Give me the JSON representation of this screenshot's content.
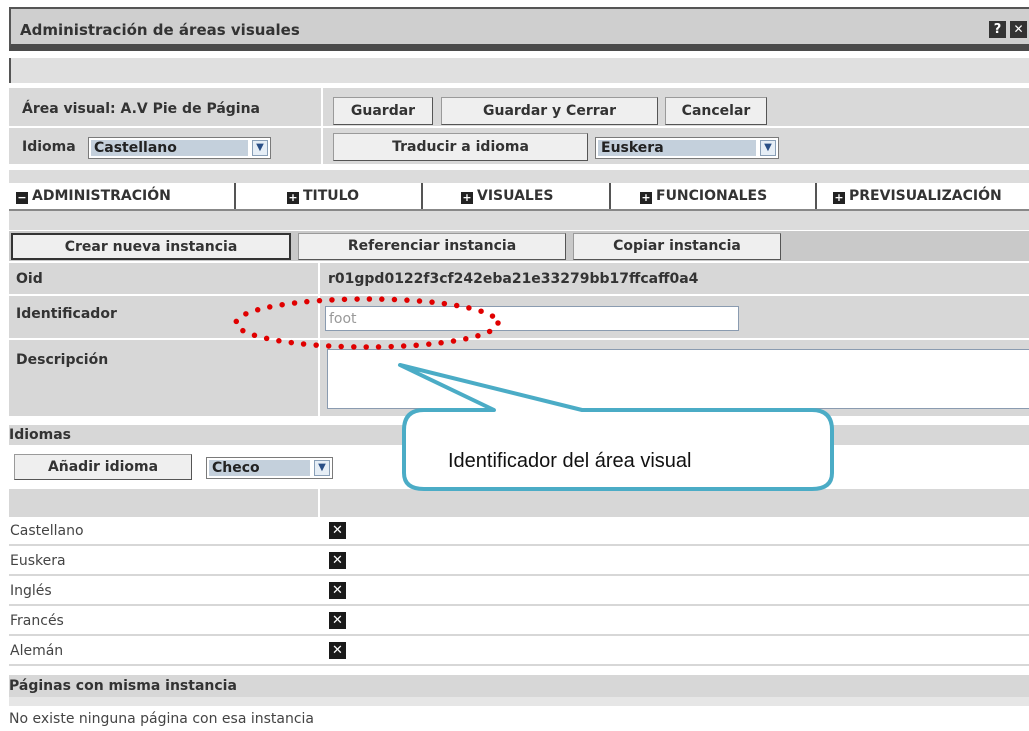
{
  "window": {
    "title": "Administración de áreas visuales",
    "help_label": "?",
    "close_label": "✕"
  },
  "header": {
    "area_label": "Área visual: A.V Pie de Página",
    "save_label": "Guardar",
    "save_close_label": "Guardar y Cerrar",
    "cancel_label": "Cancelar",
    "language_label": "Idioma",
    "language_value": "Castellano",
    "translate_label": "Traducir a idioma",
    "translate_target_value": "Euskera"
  },
  "tabs": [
    {
      "label": "ADMINISTRACIÓN",
      "icon": "minus-icon",
      "icon_glyph": "−"
    },
    {
      "label": "TITULO",
      "icon": "plus-icon",
      "icon_glyph": "+"
    },
    {
      "label": "VISUALES",
      "icon": "plus-icon",
      "icon_glyph": "+"
    },
    {
      "label": "FUNCIONALES",
      "icon": "plus-icon",
      "icon_glyph": "+"
    },
    {
      "label": "PREVISUALIZACIÓN",
      "icon": "plus-icon",
      "icon_glyph": "+"
    }
  ],
  "instance_buttons": {
    "create": "Crear nueva instancia",
    "reference": "Referenciar instancia",
    "copy": "Copiar instancia"
  },
  "form": {
    "oid_label": "Oid",
    "oid_value": "r01gpd0122f3cf242eba21e33279bb17ffcaff0a4",
    "identifier_label": "Identificador",
    "identifier_value": "foot",
    "description_label": "Descripción",
    "description_value": ""
  },
  "callout": {
    "text": "Identificador del área visual",
    "highlight_color": "#e00000",
    "border_color": "#4bacc6"
  },
  "languages": {
    "section_title": "Idiomas",
    "add_label": "Añadir idioma",
    "add_select_value": "Checo",
    "delete_icon": "delete-icon",
    "delete_glyph": "✕",
    "rows": [
      "Castellano",
      "Euskera",
      "Inglés",
      "Francés",
      "Alemán"
    ]
  },
  "pages": {
    "section_title": "Páginas con misma instancia",
    "empty_message": "No existe ninguna página con esa instancia"
  }
}
